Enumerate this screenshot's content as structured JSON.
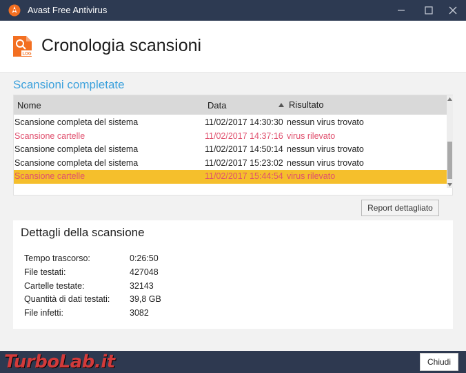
{
  "window": {
    "title": "Avast Free Antivirus",
    "icons": {
      "app": "avast-logo-icon",
      "minimize": "minimize-icon",
      "maximize": "maximize-icon",
      "close": "close-icon"
    }
  },
  "header": {
    "title": "Cronologia scansioni",
    "icon": "scan-log-icon",
    "icon_text": "LOG"
  },
  "scans": {
    "section_title": "Scansioni completate",
    "columns": {
      "name": "Nome",
      "date": "Data",
      "result": "Risultato"
    },
    "sort_icon": "sort-ascending-icon",
    "rows": [
      {
        "name": "Scansione completa del sistema",
        "date": "11/02/2017 14:30:30",
        "result": "nessun virus trovato",
        "status": "clean"
      },
      {
        "name": "Scansione cartelle",
        "date": "11/02/2017 14:37:16",
        "result": "virus rilevato",
        "status": "infected"
      },
      {
        "name": "Scansione completa del sistema",
        "date": "11/02/2017 14:50:14",
        "result": "nessun virus trovato",
        "status": "clean"
      },
      {
        "name": "Scansione completa del sistema",
        "date": "11/02/2017 15:23:02",
        "result": "nessun virus trovato",
        "status": "clean"
      },
      {
        "name": "Scansione cartelle",
        "date": "11/02/2017 15:44:54",
        "result": "virus rilevato",
        "status": "selected"
      }
    ],
    "report_button": "Report dettagliato"
  },
  "details": {
    "title": "Dettagli della scansione",
    "items": [
      {
        "label": "Tempo trascorso:",
        "value": "0:26:50"
      },
      {
        "label": "File testati:",
        "value": "427048"
      },
      {
        "label": "Cartelle testate:",
        "value": "32143"
      },
      {
        "label": "Quantità di dati testati:",
        "value": "39,8 GB"
      },
      {
        "label": "File infetti:",
        "value": "3082"
      }
    ]
  },
  "footer": {
    "close_button": "Chiudi",
    "watermark": "TurboLab.it"
  },
  "colors": {
    "titlebar": "#2d3a52",
    "accent_blue": "#3aa0dc",
    "infected_text": "#e0506e",
    "selected_row": "#f5bf2c"
  }
}
